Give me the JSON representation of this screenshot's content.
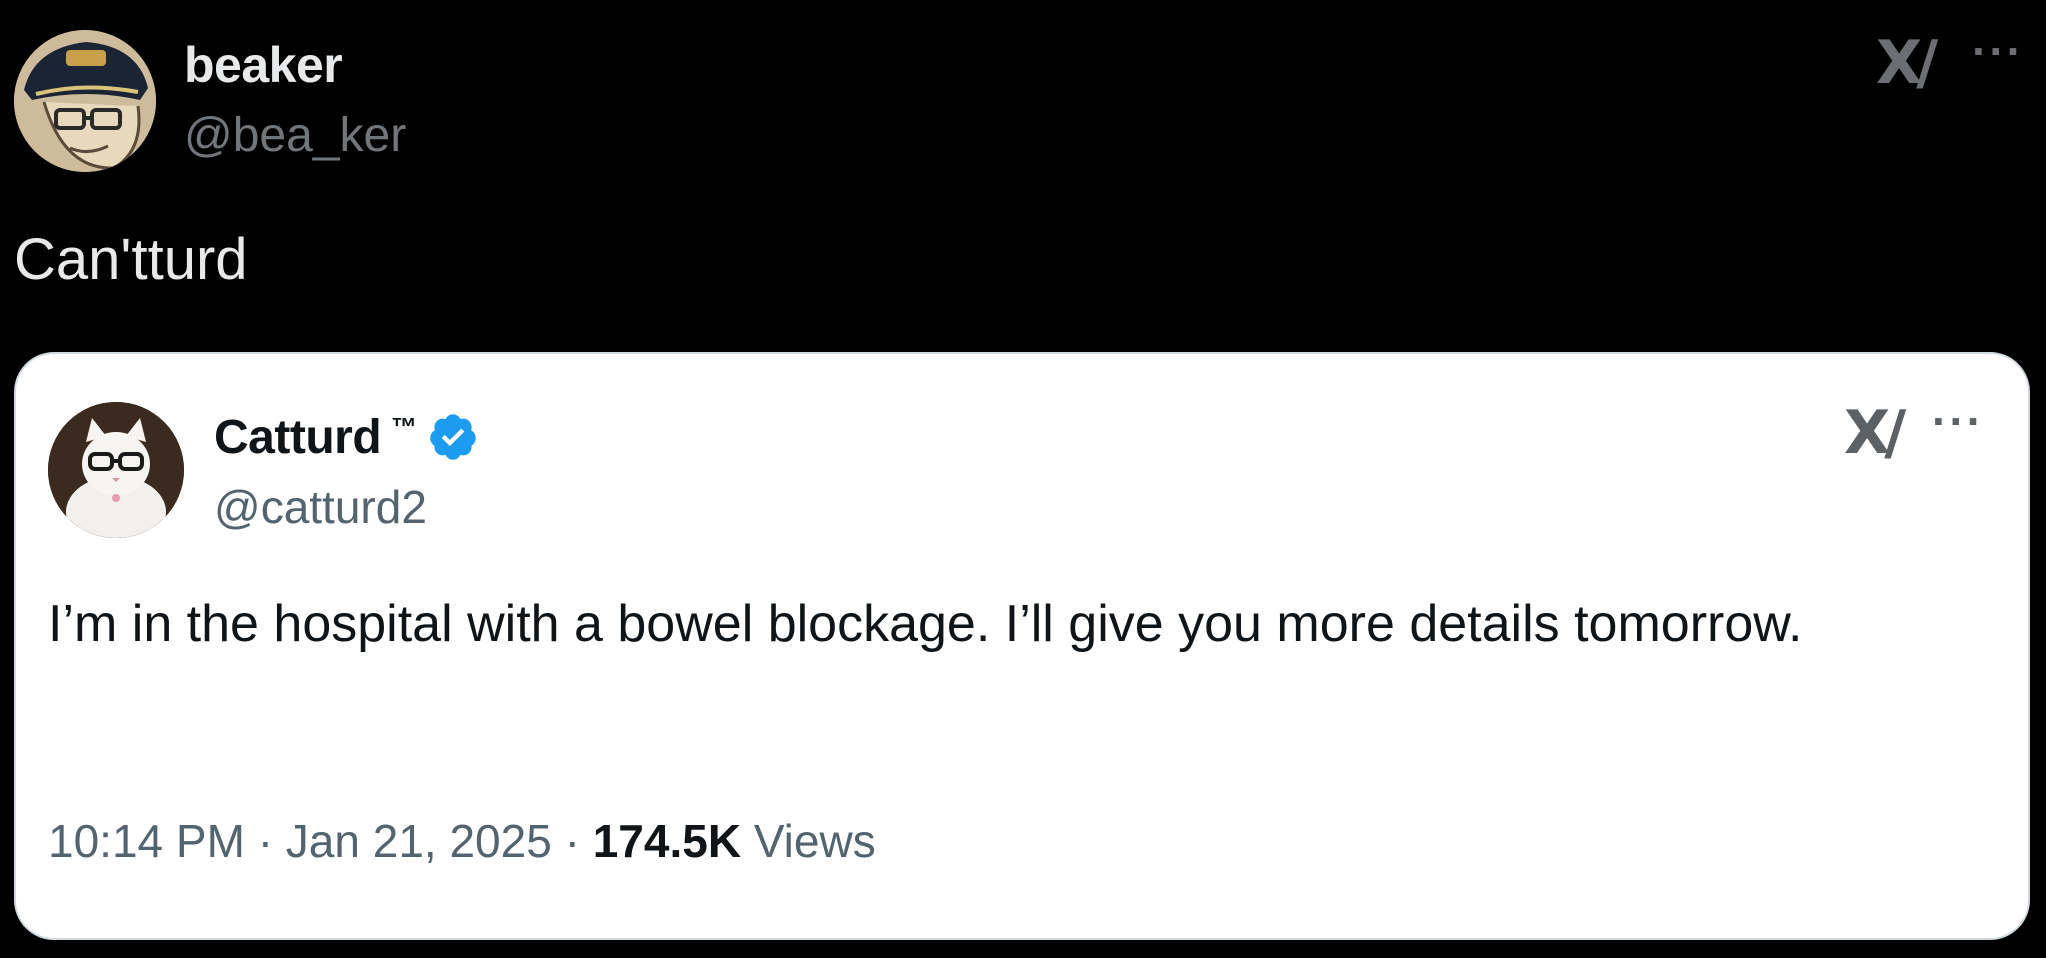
{
  "outer_post": {
    "display_name": "beaker",
    "handle": "@bea_ker",
    "text": "Can'tturd",
    "avatar_icon": "cartoon-man-with-glasses-and-captain-hat-avatar",
    "x_logo_text": "X/",
    "more_text": "···"
  },
  "quoted_post": {
    "display_name": "Catturd",
    "trademark": "™",
    "handle": "@catturd2",
    "verified_icon": "verified-badge-icon",
    "text": "I’m in the hospital with a bowel blockage. I’ll give you more details tomorrow.",
    "time": "10:14 PM",
    "separator": "·",
    "date": "Jan 21, 2025",
    "views_count": "174.5K",
    "views_label": "Views",
    "avatar_icon": "white-cat-with-glasses-avatar",
    "x_logo_text": "X/",
    "more_text": "···"
  },
  "colors": {
    "background": "#000000",
    "card_background": "#ffffff",
    "verified_blue": "#1d9bf0",
    "muted_text": "#536471"
  }
}
